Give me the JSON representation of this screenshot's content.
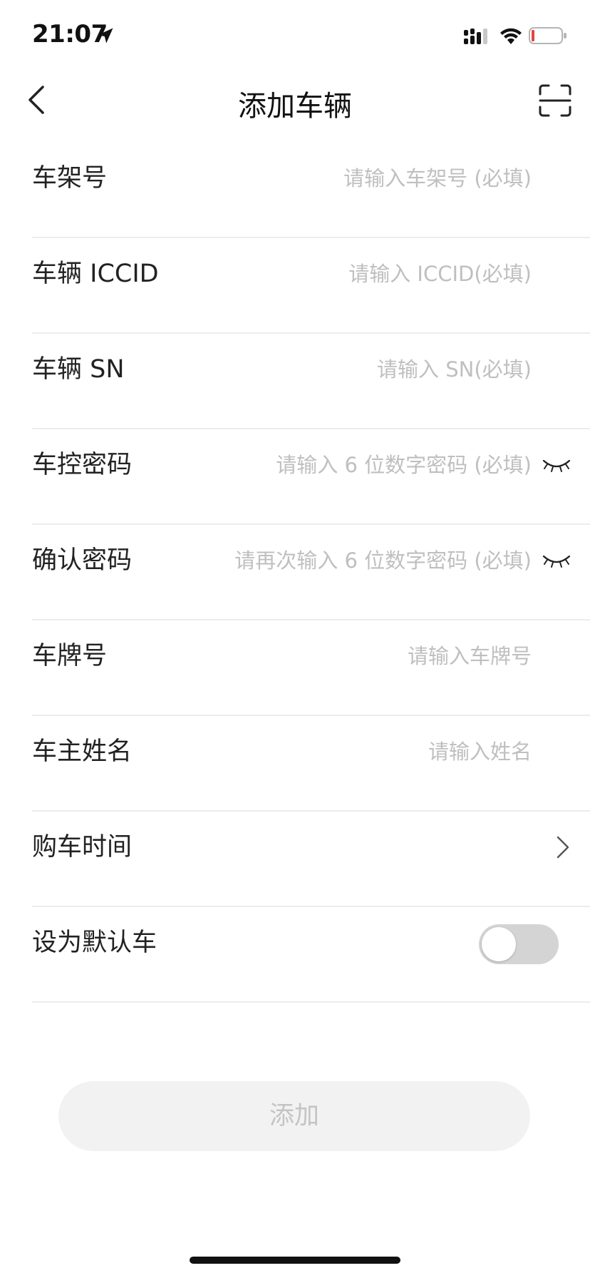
{
  "status_bar": {
    "time": "21:07",
    "location_icon": "location-arrow-icon",
    "signal_icon": "cellular-signal-icon",
    "wifi_icon": "wifi-icon",
    "battery_icon": "battery-low-icon",
    "battery_color": "#e64340"
  },
  "nav": {
    "back_icon": "chevron-left-icon",
    "title": "添加车辆",
    "scan_icon": "scan-icon"
  },
  "form": {
    "frame_number": {
      "label": "车架号",
      "placeholder": "请输入车架号 (必填)"
    },
    "iccid": {
      "label": "车辆 ICCID",
      "placeholder": "请输入 ICCID(必填)"
    },
    "sn": {
      "label": "车辆 SN",
      "placeholder": "请输入 SN(必填)"
    },
    "control_password": {
      "label": "车控密码",
      "placeholder": "请输入 6 位数字密码 (必填)",
      "eye_icon": "eye-closed-icon"
    },
    "confirm_password": {
      "label": "确认密码",
      "placeholder": "请再次输入 6 位数字密码 (必填)",
      "eye_icon": "eye-closed-icon"
    },
    "plate_number": {
      "label": "车牌号",
      "placeholder": "请输入车牌号"
    },
    "owner_name": {
      "label": "车主姓名",
      "placeholder": "请输入姓名"
    },
    "purchase_time": {
      "label": "购车时间",
      "chevron_icon": "chevron-right-icon"
    },
    "default_vehicle": {
      "label": "设为默认车",
      "enabled": false
    }
  },
  "add_button": {
    "label": "添加",
    "enabled": false
  },
  "colors": {
    "placeholder": "#bfbfbf",
    "divider": "#ececec",
    "button_bg": "#f2f2f2",
    "button_text": "#c4c4c4",
    "toggle_off": "#d4d4d4"
  }
}
